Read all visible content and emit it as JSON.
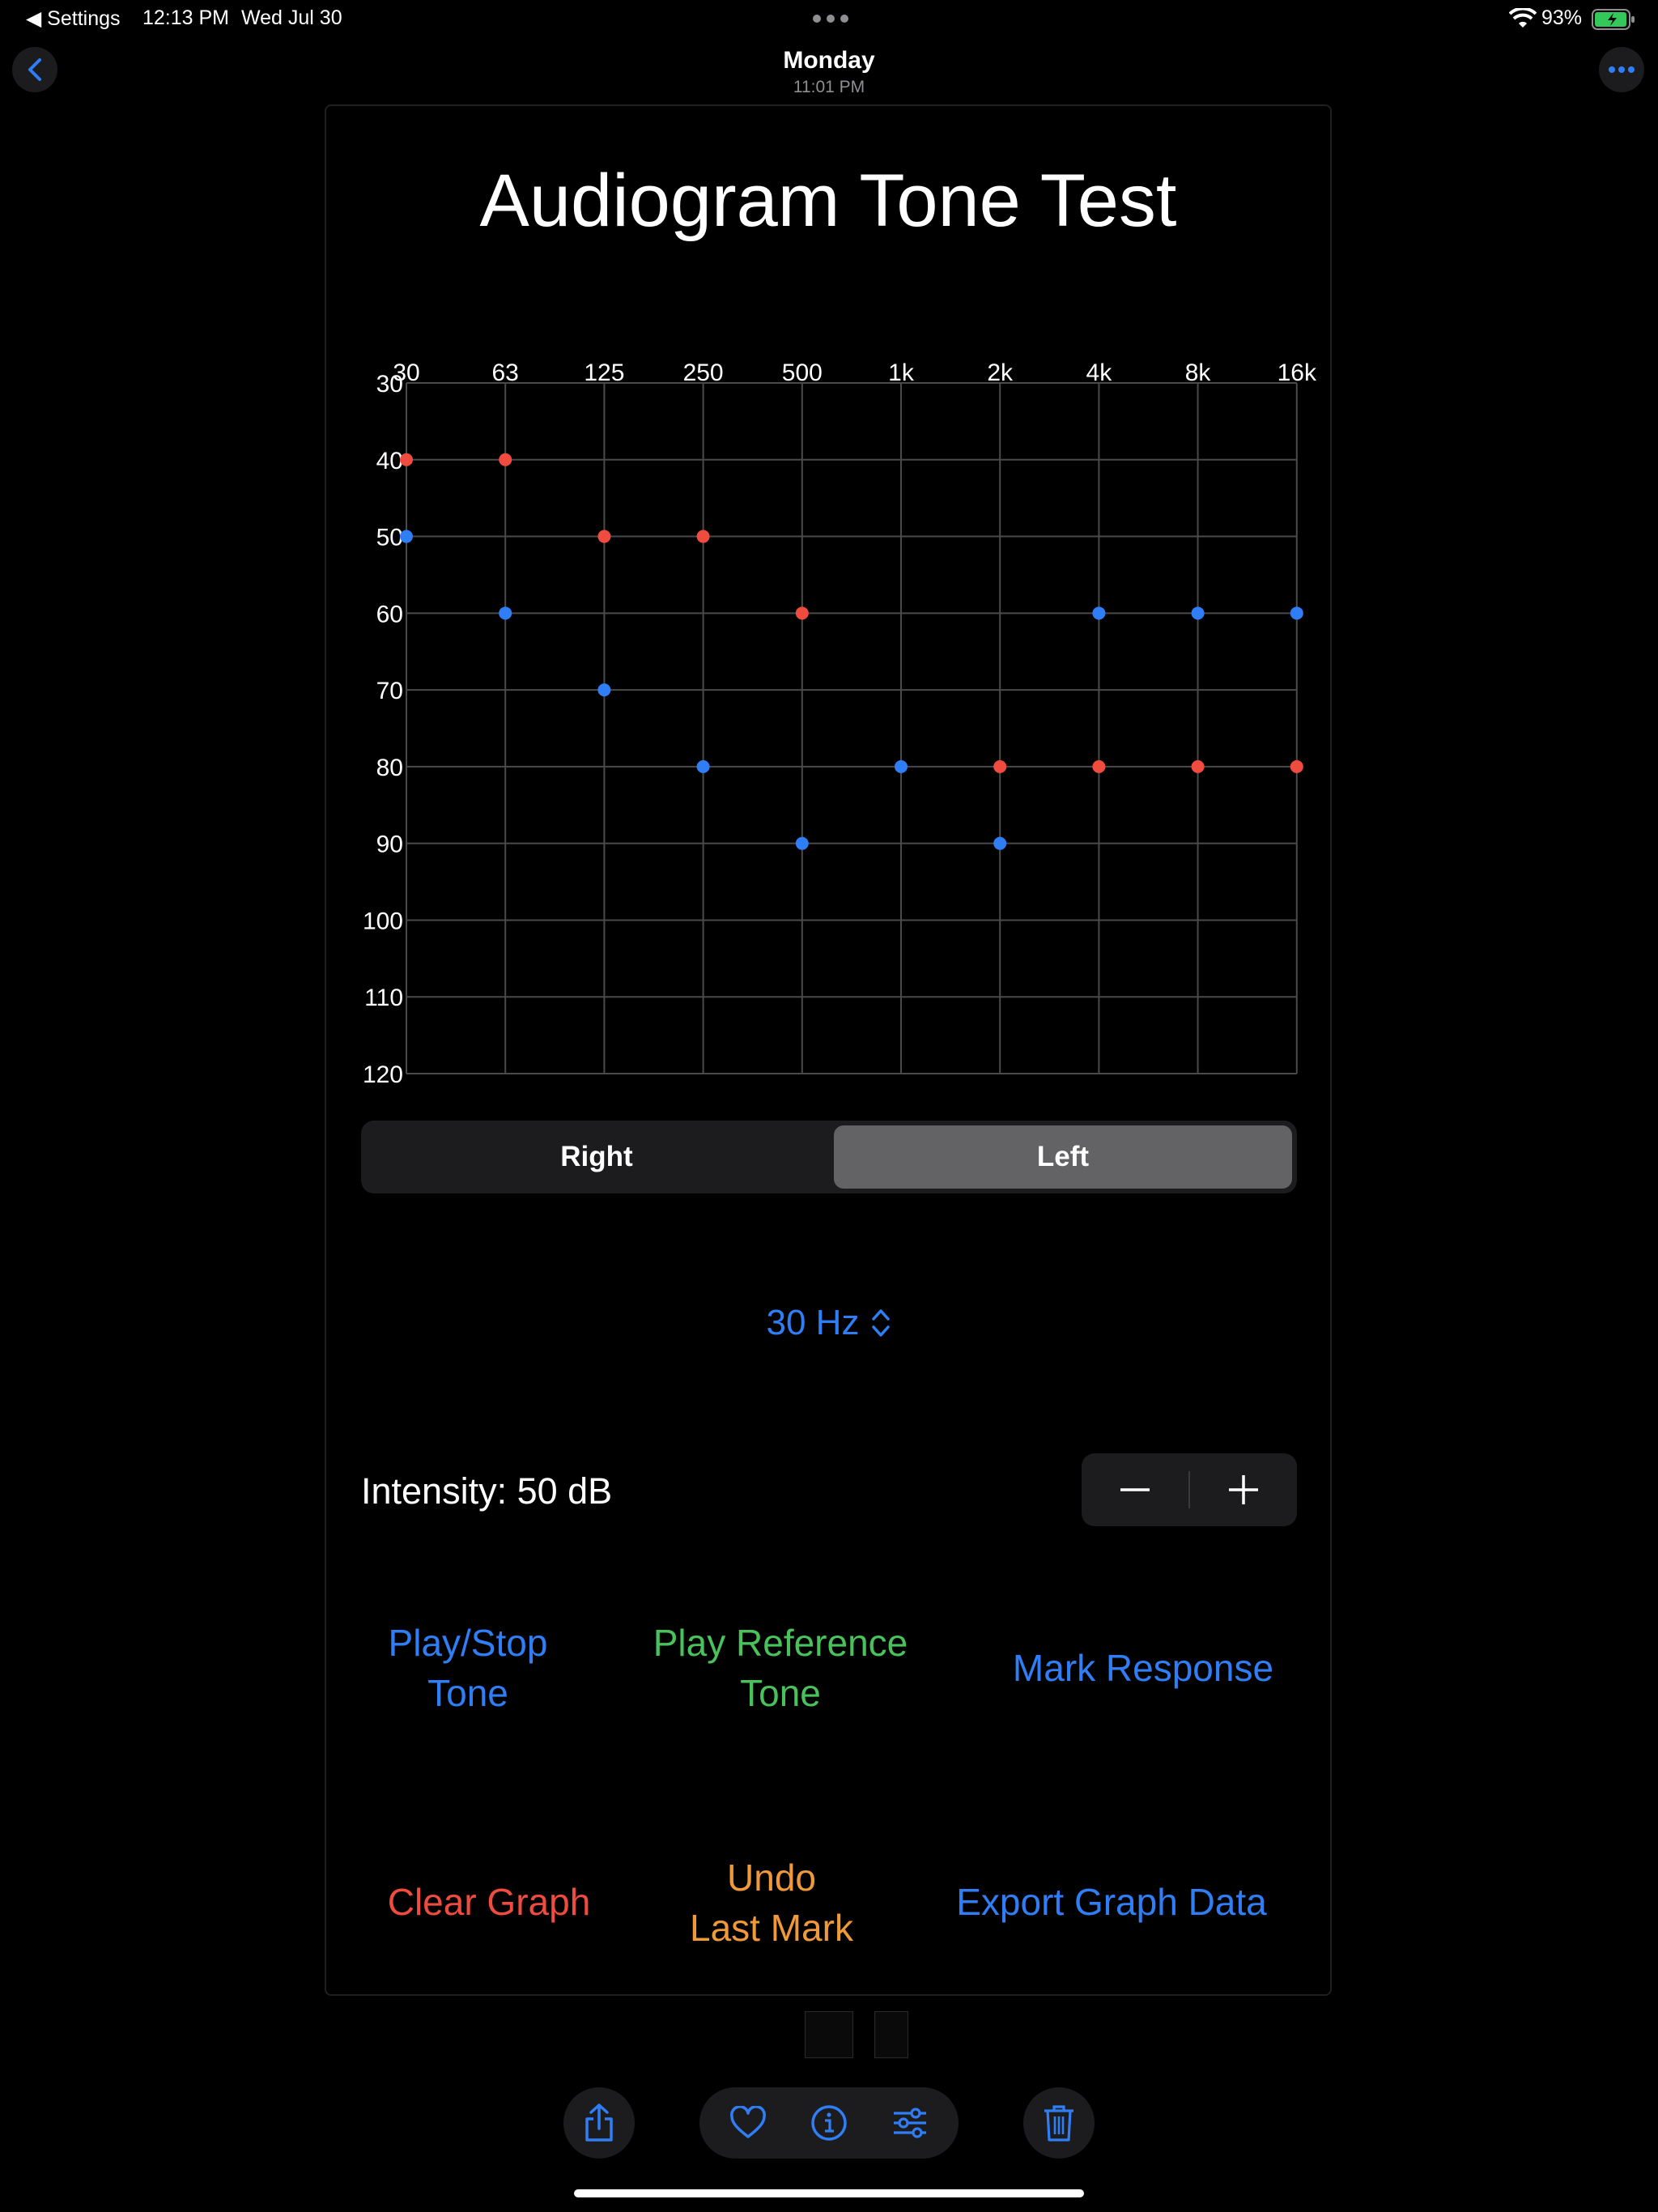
{
  "status_bar": {
    "back_app": "◀ Settings",
    "time": "12:13 PM",
    "date": "Wed Jul 30",
    "battery": "93%"
  },
  "nav": {
    "title": "Monday",
    "subtitle": "11:01 PM"
  },
  "app": {
    "title": "Audiogram Tone Test"
  },
  "chart_data": {
    "type": "scatter",
    "x_categories": [
      "30",
      "63",
      "125",
      "250",
      "500",
      "1k",
      "2k",
      "4k",
      "8k",
      "16k"
    ],
    "y_ticks": [
      30,
      40,
      50,
      60,
      70,
      80,
      90,
      100,
      110,
      120
    ],
    "ylim": [
      30,
      120
    ],
    "y_inverted": true,
    "grid": true,
    "series": [
      {
        "color": "#ef4b3f",
        "values": [
          40,
          40,
          50,
          50,
          60,
          null,
          80,
          80,
          80,
          80
        ]
      },
      {
        "color": "#2f7ef6",
        "values": [
          50,
          60,
          70,
          80,
          90,
          80,
          90,
          60,
          60,
          60
        ]
      }
    ]
  },
  "ear_selector": {
    "right_label": "Right",
    "left_label": "Left",
    "selected": "Left"
  },
  "frequency_picker": {
    "value": "30 Hz"
  },
  "intensity": {
    "label": "Intensity: 50 dB"
  },
  "actions": {
    "play_stop_line1": "Play/Stop",
    "play_stop_line2": "Tone",
    "play_ref_line1": "Play Reference",
    "play_ref_line2": "Tone",
    "mark_response": "Mark Response",
    "clear_graph": "Clear Graph",
    "undo_line1": "Undo",
    "undo_line2": "Last Mark",
    "export": "Export Graph Data"
  },
  "colors": {
    "accent_blue": "#2f7ef6",
    "green": "#49c25c",
    "red": "#ef4b3f",
    "orange": "#f0993a"
  }
}
